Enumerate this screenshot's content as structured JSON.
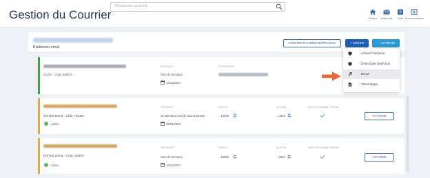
{
  "app": {
    "title": "Gestion du Courrier"
  },
  "search": {
    "placeholder": "Rechercher un achat"
  },
  "nav": [
    {
      "label": "Retour",
      "icon": "home-icon"
    },
    {
      "label": "Webmail",
      "icon": "mail-icon"
    },
    {
      "label": "Aide",
      "icon": "help-icon"
    },
    {
      "label": "Documentation",
      "icon": "documentation-icon"
    }
  ],
  "domain": {
    "count": "5",
    "count_suffix": "Adresses email"
  },
  "toolbar": {
    "buy_label": "ACHETER D'AUTRES BOÎTES MAIL",
    "create_label": "+ CRÉER",
    "actions_label": "⋮ ACTIONS"
  },
  "dropdown": {
    "items": [
      {
        "label": "Activer l'antivirus",
        "icon": "shield-icon"
      },
      {
        "label": "Désactiver l'antivirus",
        "icon": "shield-icon"
      },
      {
        "label": "DKIM",
        "icon": "key-icon"
      },
      {
        "label": "Télécharger",
        "icon": "download-icon"
      }
    ],
    "highlighted_index": 2
  },
  "columns": {
    "produit": "PRODUIT",
    "adresses": "ADRESSES",
    "envoi": "ENVOI",
    "quota": "QUOTA",
    "antivirus": "ANTIVIRUS/ANTISPAM"
  },
  "cards": [
    {
      "type": "ALIAS - COM: 448575",
      "product": "Nom de domaine",
      "date": "14/11/2023",
      "accent": "#3aa845"
    },
    {
      "type": "BOÎTES EMAIL - COM: 782404",
      "product": "10 adresses mail de 2Go d'espace",
      "date": "28/04/2023",
      "status": "Active",
      "envoi": "...10000",
      "quota": "...2028",
      "actions": "ACTIONS",
      "accent": "#f0a63a"
    },
    {
      "type": "BOÎTES EMAIL - COM: 448575",
      "product": "Nom de domaine",
      "date": "14/11/2023",
      "status": "Active",
      "envoi": "...10000",
      "quota": "...2028",
      "actions": "ACTIONS",
      "accent": "#f0a63a"
    }
  ],
  "colors": {
    "primary": "#1e5fb8",
    "actions": "#2b9ad3",
    "arrow": "#e8693a",
    "success": "#5cb85c"
  }
}
